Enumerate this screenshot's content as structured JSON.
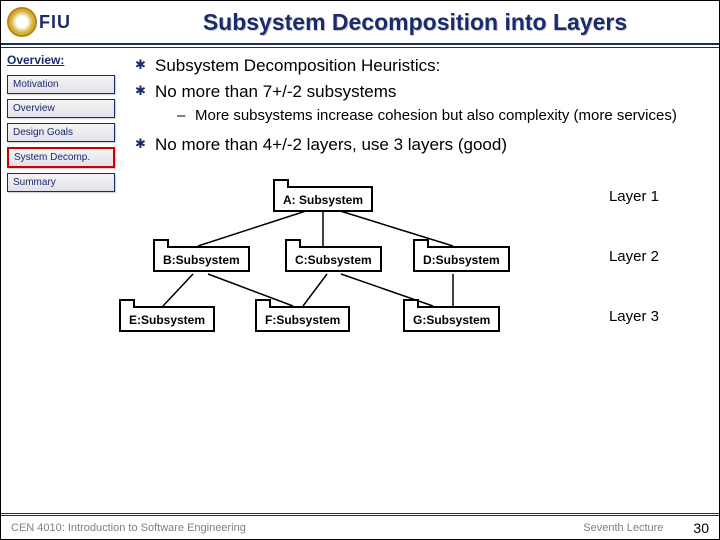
{
  "header": {
    "institution": "FIU",
    "title": "Subsystem Decomposition into Layers"
  },
  "sidebar": {
    "heading": "Overview:",
    "items": [
      {
        "label": "Motivation",
        "active": false
      },
      {
        "label": "Overview",
        "active": false
      },
      {
        "label": "Design Goals",
        "active": false
      },
      {
        "label": "System Decomp.",
        "active": true
      },
      {
        "label": "Summary",
        "active": false
      }
    ]
  },
  "content": {
    "bullets": [
      "Subsystem Decomposition Heuristics:",
      "No more than 7+/-2 subsystems",
      "No more than 4+/-2 layers, use 3 layers (good)"
    ],
    "sub_bullet": "More subsystems increase cohesion but also complexity (more services)"
  },
  "diagram": {
    "nodes": {
      "A": "A: Subsystem",
      "B": "B:Subsystem",
      "C": "C:Subsystem",
      "D": "D:Subsystem",
      "E": "E:Subsystem",
      "F": "F:Subsystem",
      "G": "G:Subsystem"
    },
    "layers": [
      "Layer 1",
      "Layer 2",
      "Layer 3"
    ]
  },
  "footer": {
    "course": "CEN 4010: Introduction to Software Engineering",
    "lecture": "Seventh Lecture",
    "page": "30"
  }
}
